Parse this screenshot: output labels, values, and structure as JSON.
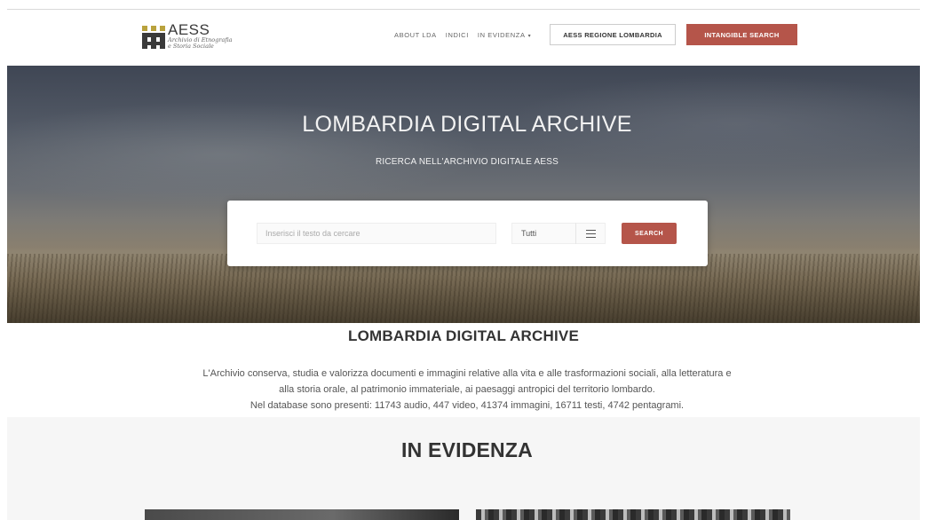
{
  "header": {
    "logo": {
      "title": "AESS",
      "subtitle_line1": "Archivio di Etnografia",
      "subtitle_line2": "e Storia Sociale"
    },
    "nav": [
      {
        "label": "ABOUT LDA"
      },
      {
        "label": "INDICI"
      },
      {
        "label": "IN EVIDENZA",
        "has_dropdown": true
      }
    ],
    "regione_button": "AESS REGIONE LOMBARDIA",
    "intangible_button": "INTANGIBLE SEARCH",
    "accent_color": "#b5554a"
  },
  "hero": {
    "title": "LOMBARDIA DIGITAL ARCHIVE",
    "subtitle": "RICERCA NELL'ARCHIVIO DIGITALE AESS",
    "search": {
      "placeholder": "Inserisci il testo da cercare",
      "value": "",
      "filter_selected": "Tutti",
      "button_label": "SEARCH"
    }
  },
  "intro": {
    "title": "LOMBARDIA DIGITAL ARCHIVE",
    "line1": "L'Archivio conserva, studia e valorizza documenti e immagini relative alla vita e alle trasformazioni sociali, alla letteratura e",
    "line2": "alla storia orale, al patrimonio immateriale, ai paesaggi antropici del territorio lombardo.",
    "line3": "Nel database sono presenti: 11743 audio, 447 video, 41374 immagini, 16711 testi, 4742 pentagrami."
  },
  "evidenza": {
    "title": "IN EVIDENZA"
  }
}
